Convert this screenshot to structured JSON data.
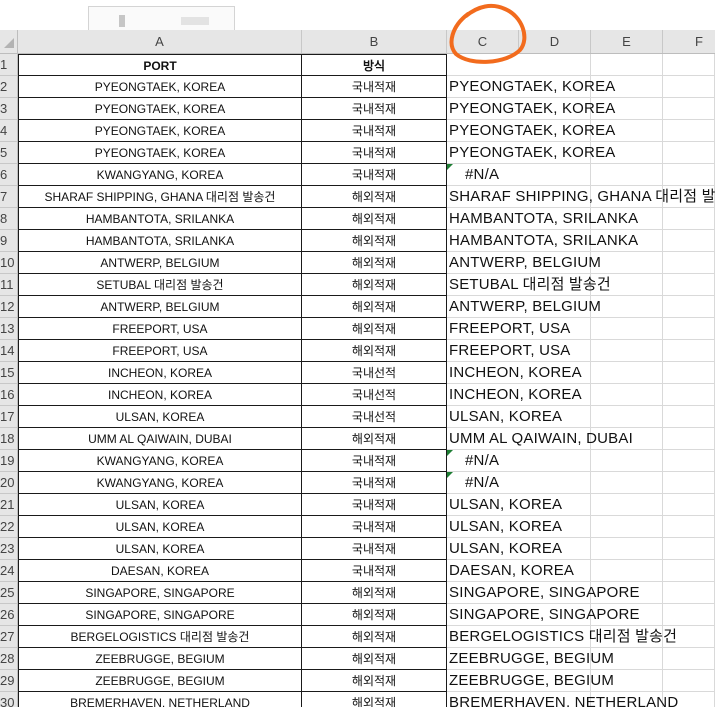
{
  "columns": [
    "A",
    "B",
    "C",
    "D",
    "E",
    "F"
  ],
  "rows": [
    "1",
    "2",
    "3",
    "4",
    "5",
    "6",
    "7",
    "8",
    "9",
    "10",
    "11",
    "12",
    "13",
    "14",
    "15",
    "16",
    "17",
    "18",
    "19",
    "20",
    "21",
    "22",
    "23",
    "24",
    "25",
    "26",
    "27",
    "28",
    "29",
    "30"
  ],
  "header": {
    "a": "PORT",
    "b": "방식",
    "c": ""
  },
  "data": [
    {
      "a": "PYEONGTAEK, KOREA",
      "b": "국내적재",
      "c": "PYEONGTAEK, KOREA"
    },
    {
      "a": "PYEONGTAEK, KOREA",
      "b": "국내적재",
      "c": "PYEONGTAEK, KOREA"
    },
    {
      "a": "PYEONGTAEK, KOREA",
      "b": "국내적재",
      "c": "PYEONGTAEK, KOREA"
    },
    {
      "a": "PYEONGTAEK, KOREA",
      "b": "국내적재",
      "c": "PYEONGTAEK, KOREA"
    },
    {
      "a": "KWANGYANG, KOREA",
      "b": "국내적재",
      "c": "#N/A"
    },
    {
      "a": "SHARAF SHIPPING, GHANA 대리점 발송건",
      "b": "해외적재",
      "c": "SHARAF SHIPPING, GHANA 대리점 발송"
    },
    {
      "a": "HAMBANTOTA, SRILANKA",
      "b": "해외적재",
      "c": "HAMBANTOTA, SRILANKA"
    },
    {
      "a": "HAMBANTOTA, SRILANKA",
      "b": "해외적재",
      "c": "HAMBANTOTA, SRILANKA"
    },
    {
      "a": "ANTWERP, BELGIUM",
      "b": "해외적재",
      "c": "ANTWERP, BELGIUM"
    },
    {
      "a": "SETUBAL 대리점 발송건",
      "b": "해외적재",
      "c": "SETUBAL 대리점 발송건"
    },
    {
      "a": "ANTWERP, BELGIUM",
      "b": "해외적재",
      "c": "ANTWERP, BELGIUM"
    },
    {
      "a": "FREEPORT, USA",
      "b": "해외적재",
      "c": "FREEPORT, USA"
    },
    {
      "a": "FREEPORT, USA",
      "b": "해외적재",
      "c": "FREEPORT, USA"
    },
    {
      "a": "INCHEON, KOREA",
      "b": "국내선적",
      "c": "INCHEON, KOREA"
    },
    {
      "a": "INCHEON, KOREA",
      "b": "국내선적",
      "c": "INCHEON, KOREA"
    },
    {
      "a": "ULSAN, KOREA",
      "b": "국내선적",
      "c": "ULSAN, KOREA"
    },
    {
      "a": "UMM AL QAIWAIN, DUBAI",
      "b": "해외적재",
      "c": "UMM AL QAIWAIN, DUBAI"
    },
    {
      "a": "KWANGYANG, KOREA",
      "b": "국내적재",
      "c": "#N/A"
    },
    {
      "a": "KWANGYANG, KOREA",
      "b": "국내적재",
      "c": "#N/A"
    },
    {
      "a": "ULSAN, KOREA",
      "b": "국내적재",
      "c": "ULSAN, KOREA"
    },
    {
      "a": "ULSAN, KOREA",
      "b": "국내적재",
      "c": "ULSAN, KOREA"
    },
    {
      "a": "ULSAN, KOREA",
      "b": "국내적재",
      "c": "ULSAN, KOREA"
    },
    {
      "a": "DAESAN, KOREA",
      "b": "국내적재",
      "c": "DAESAN, KOREA"
    },
    {
      "a": "SINGAPORE, SINGAPORE",
      "b": "해외적재",
      "c": "SINGAPORE, SINGAPORE"
    },
    {
      "a": "SINGAPORE, SINGAPORE",
      "b": "해외적재",
      "c": "SINGAPORE, SINGAPORE"
    },
    {
      "a": "BERGELOGISTICS 대리점 발송건",
      "b": "해외적재",
      "c": "BERGELOGISTICS 대리점 발송건"
    },
    {
      "a": "ZEEBRUGGE, BEGIUM",
      "b": "해외적재",
      "c": "ZEEBRUGGE, BEGIUM"
    },
    {
      "a": "ZEEBRUGGE, BEGIUM",
      "b": "해외적재",
      "c": "ZEEBRUGGE, BEGIUM"
    },
    {
      "a": "BREMERHAVEN, NETHERLAND",
      "b": "해외적재",
      "c": "BREMERHAVEN, NETHERLAND"
    }
  ],
  "colors": {
    "annotation": "#f26b1d",
    "error_triangle": "#1e7e34",
    "header_bg": "#e6e6e6"
  }
}
